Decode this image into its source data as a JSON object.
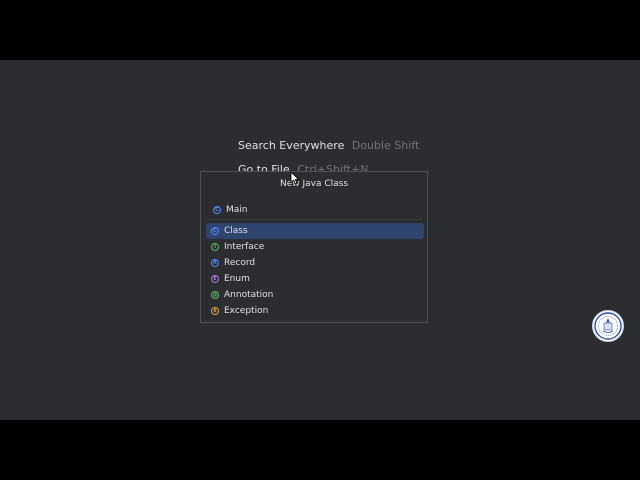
{
  "hints": [
    {
      "label": "Search Everywhere",
      "shortcut": "Double Shift"
    },
    {
      "label": "Go to File",
      "shortcut": "Ctrl+Shift+N"
    }
  ],
  "dialog": {
    "title": "New Java Class",
    "name_value": "Main",
    "name_icon": {
      "glyph": "C",
      "color": "#548af7",
      "icon": "class-icon"
    },
    "selected_index": 0,
    "items": [
      {
        "label": "Class",
        "glyph": "C",
        "color": "#548af7",
        "icon": "class-icon"
      },
      {
        "label": "Interface",
        "glyph": "I",
        "color": "#5fb865",
        "icon": "interface-icon"
      },
      {
        "label": "Record",
        "glyph": "R",
        "color": "#548af7",
        "icon": "record-icon"
      },
      {
        "label": "Enum",
        "glyph": "E",
        "color": "#b07ae8",
        "icon": "enum-icon"
      },
      {
        "label": "Annotation",
        "glyph": "@",
        "color": "#5fb865",
        "icon": "annotation-icon"
      },
      {
        "label": "Exception",
        "glyph": "$",
        "color": "#e0a54a",
        "icon": "exception-icon"
      }
    ]
  },
  "colors": {
    "background": "#2b2d30",
    "selection": "#2e436e",
    "text": "#dfe1e5",
    "shortcut_text": "#6f737a"
  }
}
